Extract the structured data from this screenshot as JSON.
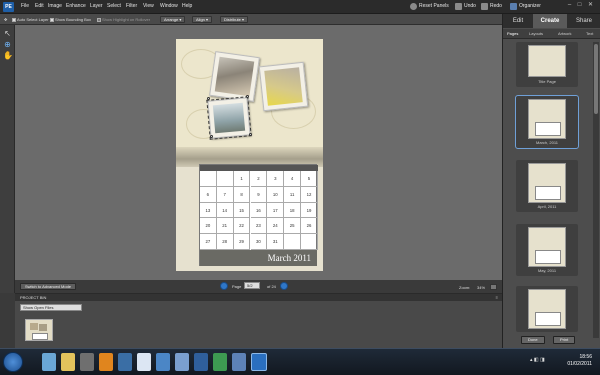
{
  "app": {
    "logo_text": "PE"
  },
  "menu": [
    "File",
    "Edit",
    "Image",
    "Enhance",
    "Layer",
    "Select",
    "Filter",
    "View",
    "Window",
    "Help"
  ],
  "top_actions": {
    "reset_panels": "Reset Panels",
    "undo": "Undo",
    "redo": "Redo",
    "organizer": "Organizer"
  },
  "options_bar": {
    "auto_select_layer": "Auto Select Layer",
    "show_bounding_box": "Show Bounding Box",
    "show_highlight": "Show Highlight on Rollover",
    "arrange": "Arrange ▾",
    "align": "Align ▾",
    "distribute": "Distribute ▾"
  },
  "calendar": {
    "month_label": "March  2011",
    "rows": [
      [
        "",
        "",
        "1",
        "2",
        "3",
        "4",
        "5"
      ],
      [
        "6",
        "7",
        "8",
        "9",
        "10",
        "11",
        "12"
      ],
      [
        "13",
        "14",
        "15",
        "16",
        "17",
        "18",
        "19"
      ],
      [
        "20",
        "21",
        "22",
        "23",
        "24",
        "25",
        "26"
      ],
      [
        "27",
        "28",
        "29",
        "30",
        "31",
        "",
        ""
      ]
    ]
  },
  "bottom_controls": {
    "advanced_mode_button": "Switch to Advanced Mode",
    "page_label": "Page",
    "page_value": "5/2",
    "page_of": "of 24",
    "zoom_label": "Zoom:",
    "zoom_value": "34%"
  },
  "project_bin": {
    "title": "PROJECT BIN",
    "select_value": "Show Open Files"
  },
  "right_panel": {
    "tabs": [
      "Edit",
      "Create",
      "Share"
    ],
    "active_tab": "Create",
    "subtabs": [
      "Pages",
      "Layouts",
      "Artwork",
      "Text"
    ],
    "pages": [
      {
        "label": "Title Page"
      },
      {
        "label": "March, 2011"
      },
      {
        "label": "April, 2011"
      },
      {
        "label": "May, 2011"
      },
      {
        "label": ""
      }
    ],
    "done_button": "Done",
    "print_button": "Print"
  },
  "taskbar": {
    "time": "18:56",
    "date": "01/02/2011"
  },
  "colors": {
    "accent_blue": "#2f77c8",
    "canvas_gray": "#6b6b6b",
    "page_cream": "#e6e1cf"
  }
}
